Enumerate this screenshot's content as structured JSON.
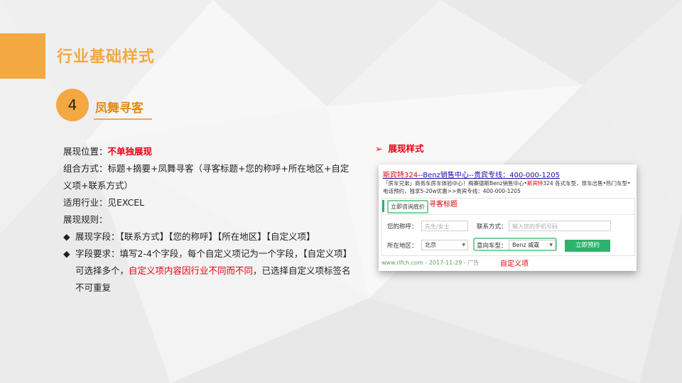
{
  "slide": {
    "title": "行业基础样式",
    "badge_number": "4",
    "badge_label": "凤舞寻客"
  },
  "content": {
    "position_label": "展现位置：",
    "position_value": "不单独展现",
    "combo_line1": "组合方式：标题+摘要+凤舞寻客（寻客标题+您的称呼+所在地区+自定",
    "combo_line2": "义项+联系方式）",
    "industry": "适用行业：见EXCEL",
    "rules_label": "展现规则：",
    "bullet_glyph": "◆",
    "rule1": "展现字段：【联系方式】【您的称呼】【所在地区】【自定义项】",
    "rule2_line1": "字段要求：填写2-4个字段，每个自定义项记为一个字段，【自定义项】",
    "rule2_line2_pre": "可选择多个，",
    "rule2_line2_red": "自定义项内容因行业不同而不同",
    "rule2_line2_post": "，已选择自定义项标签名",
    "rule2_line3": "不可重复"
  },
  "preview": {
    "header_arrow": "➢",
    "header": "展现样式",
    "ad_title_kw": "斯宾特324",
    "ad_title_rest": "--Benz销售中心--贵宾专线：400-000-1205",
    "ad_desc_1": "「房车兄弟」商务车房车体验中心！梅赛德斯Benz销售中心•",
    "ad_desc_kw": "斯宾特",
    "ad_desc_2": "324 各式车型，现车出售•热门车型•电话预约，独享5-20w优惠>>贵宾专线：400-000-1205",
    "tag": "立即咨询底价",
    "tag_note": "寻客标题",
    "name_label": "您的称呼：",
    "name_placeholder": "先生/女士",
    "contact_label": "联系方式：",
    "contact_placeholder": "输入您的手机号码",
    "region_label": "所在地区：",
    "region_value": "北京",
    "car_label": "意向车型：",
    "car_value": "Benz 威霆",
    "submit": "立即预约",
    "footer_url": "www.rlfch.com - 2017-11-29 - ",
    "footer_ad": "广告",
    "custom_note": "自定义项"
  },
  "colors": {
    "accent": "#f3a842",
    "highlight": "#e60012",
    "green": "#2db36b"
  }
}
